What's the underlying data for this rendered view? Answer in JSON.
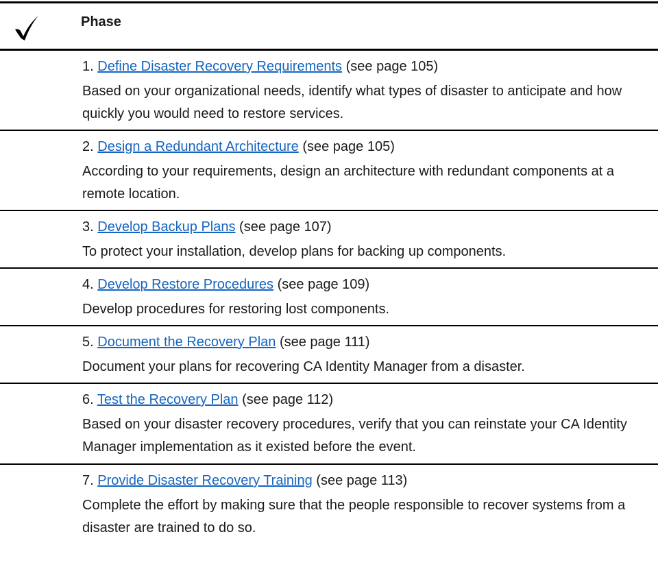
{
  "header": {
    "check_symbol": "✔",
    "phase_label": "Phase"
  },
  "rows": [
    {
      "number": "1.",
      "link": "Define Disaster Recovery Requirements",
      "page_ref": "(see page 105)",
      "description": "Based on your organizational needs, identify what types of disaster to anticipate and how quickly you would need to restore services."
    },
    {
      "number": "2.",
      "link": "Design a Redundant Architecture",
      "page_ref": "(see page 105)",
      "description": "According to your requirements, design an architecture with redundant components at a remote location."
    },
    {
      "number": "3.",
      "link": "Develop Backup Plans",
      "page_ref": "(see page 107)",
      "description": "To protect your installation, develop plans for backing up components."
    },
    {
      "number": "4.",
      "link": "Develop Restore Procedures",
      "page_ref": "(see page 109)",
      "description": "Develop procedures for restoring lost components."
    },
    {
      "number": "5.",
      "link": "Document the Recovery Plan",
      "page_ref": "(see page 111)",
      "description": "Document your plans for recovering CA Identity Manager from a disaster."
    },
    {
      "number": "6.",
      "link": "Test the Recovery Plan",
      "page_ref": "(see page 112)",
      "description": "Based on your disaster recovery procedures, verify that you can reinstate your CA Identity Manager implementation as it existed before the event."
    },
    {
      "number": "7.",
      "link": "Provide Disaster Recovery Training",
      "page_ref": "(see page 113)",
      "description": "Complete the effort by making sure that the people responsible to recover systems from a disaster are trained to do so."
    }
  ]
}
